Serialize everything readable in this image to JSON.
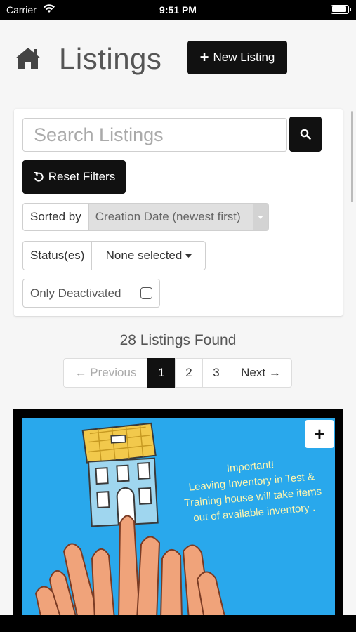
{
  "status_bar": {
    "carrier": "Carrier",
    "time": "9:51 PM"
  },
  "header": {
    "title": "Listings",
    "new_listing_label": "New Listing"
  },
  "filters": {
    "search_placeholder": "Search Listings",
    "reset_label": "Reset Filters",
    "sort_label": "Sorted by",
    "sort_value": "Creation Date (newest first)",
    "status_label": "Status(es)",
    "status_value": "None selected",
    "only_deactivated_label": "Only Deactivated",
    "only_deactivated_checked": false
  },
  "results": {
    "count_text": "28 Listings Found"
  },
  "pagination": {
    "previous": "← Previous",
    "pages": [
      "1",
      "2",
      "3"
    ],
    "current": "1",
    "next": "Next →"
  },
  "listing_card": {
    "notice_lines": [
      "Important!",
      "Leaving Inventory in Test &",
      "Training house will take items",
      "out of available inventory ."
    ],
    "add_icon": "plus-icon"
  },
  "colors": {
    "primary_button": "#111111",
    "image_bg": "#29a8ec",
    "page_bg": "#f6f6f6"
  }
}
